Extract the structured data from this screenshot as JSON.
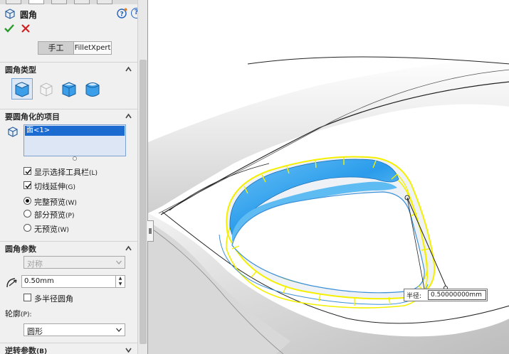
{
  "panel": {
    "title": "圆角",
    "mode_tabs": [
      "手工",
      "FilletXpert"
    ],
    "sections": {
      "fillet_type": "圆角类型",
      "items_to_fillet": "要圆角化的项目",
      "fillet_params": "圆角参数",
      "reverse_params": "逆转参数",
      "reverse_params_key": "(B)"
    },
    "selection_items": [
      "面<1>"
    ],
    "checkboxes": [
      {
        "label": "显示选择工具栏",
        "key": "(L)",
        "checked": true
      },
      {
        "label": "切线延伸",
        "key": "(G)",
        "checked": true
      }
    ],
    "radios": [
      {
        "label": "完整预览",
        "key": "(W)",
        "selected": true
      },
      {
        "label": "部分预览",
        "key": "(P)",
        "selected": false
      },
      {
        "label": "无预览",
        "key": "(W)",
        "selected": false
      }
    ],
    "symmetric_select": "对称",
    "radius_value": "0.50mm",
    "multi_radius": {
      "label": "多半径圆角",
      "checked": false
    },
    "profile_label": "轮廓",
    "profile_key": "(P):",
    "profile_value": "圆形"
  },
  "viewport": {
    "radius_caption": "半径:",
    "radius_value": "0.50000000mm"
  },
  "colors": {
    "preview_yellow": "#f4f000",
    "face_blue": "#34a6f0",
    "ok_green": "#2a9a2a",
    "cancel_red": "#d02020",
    "selected_item": "#1c6bd1"
  }
}
